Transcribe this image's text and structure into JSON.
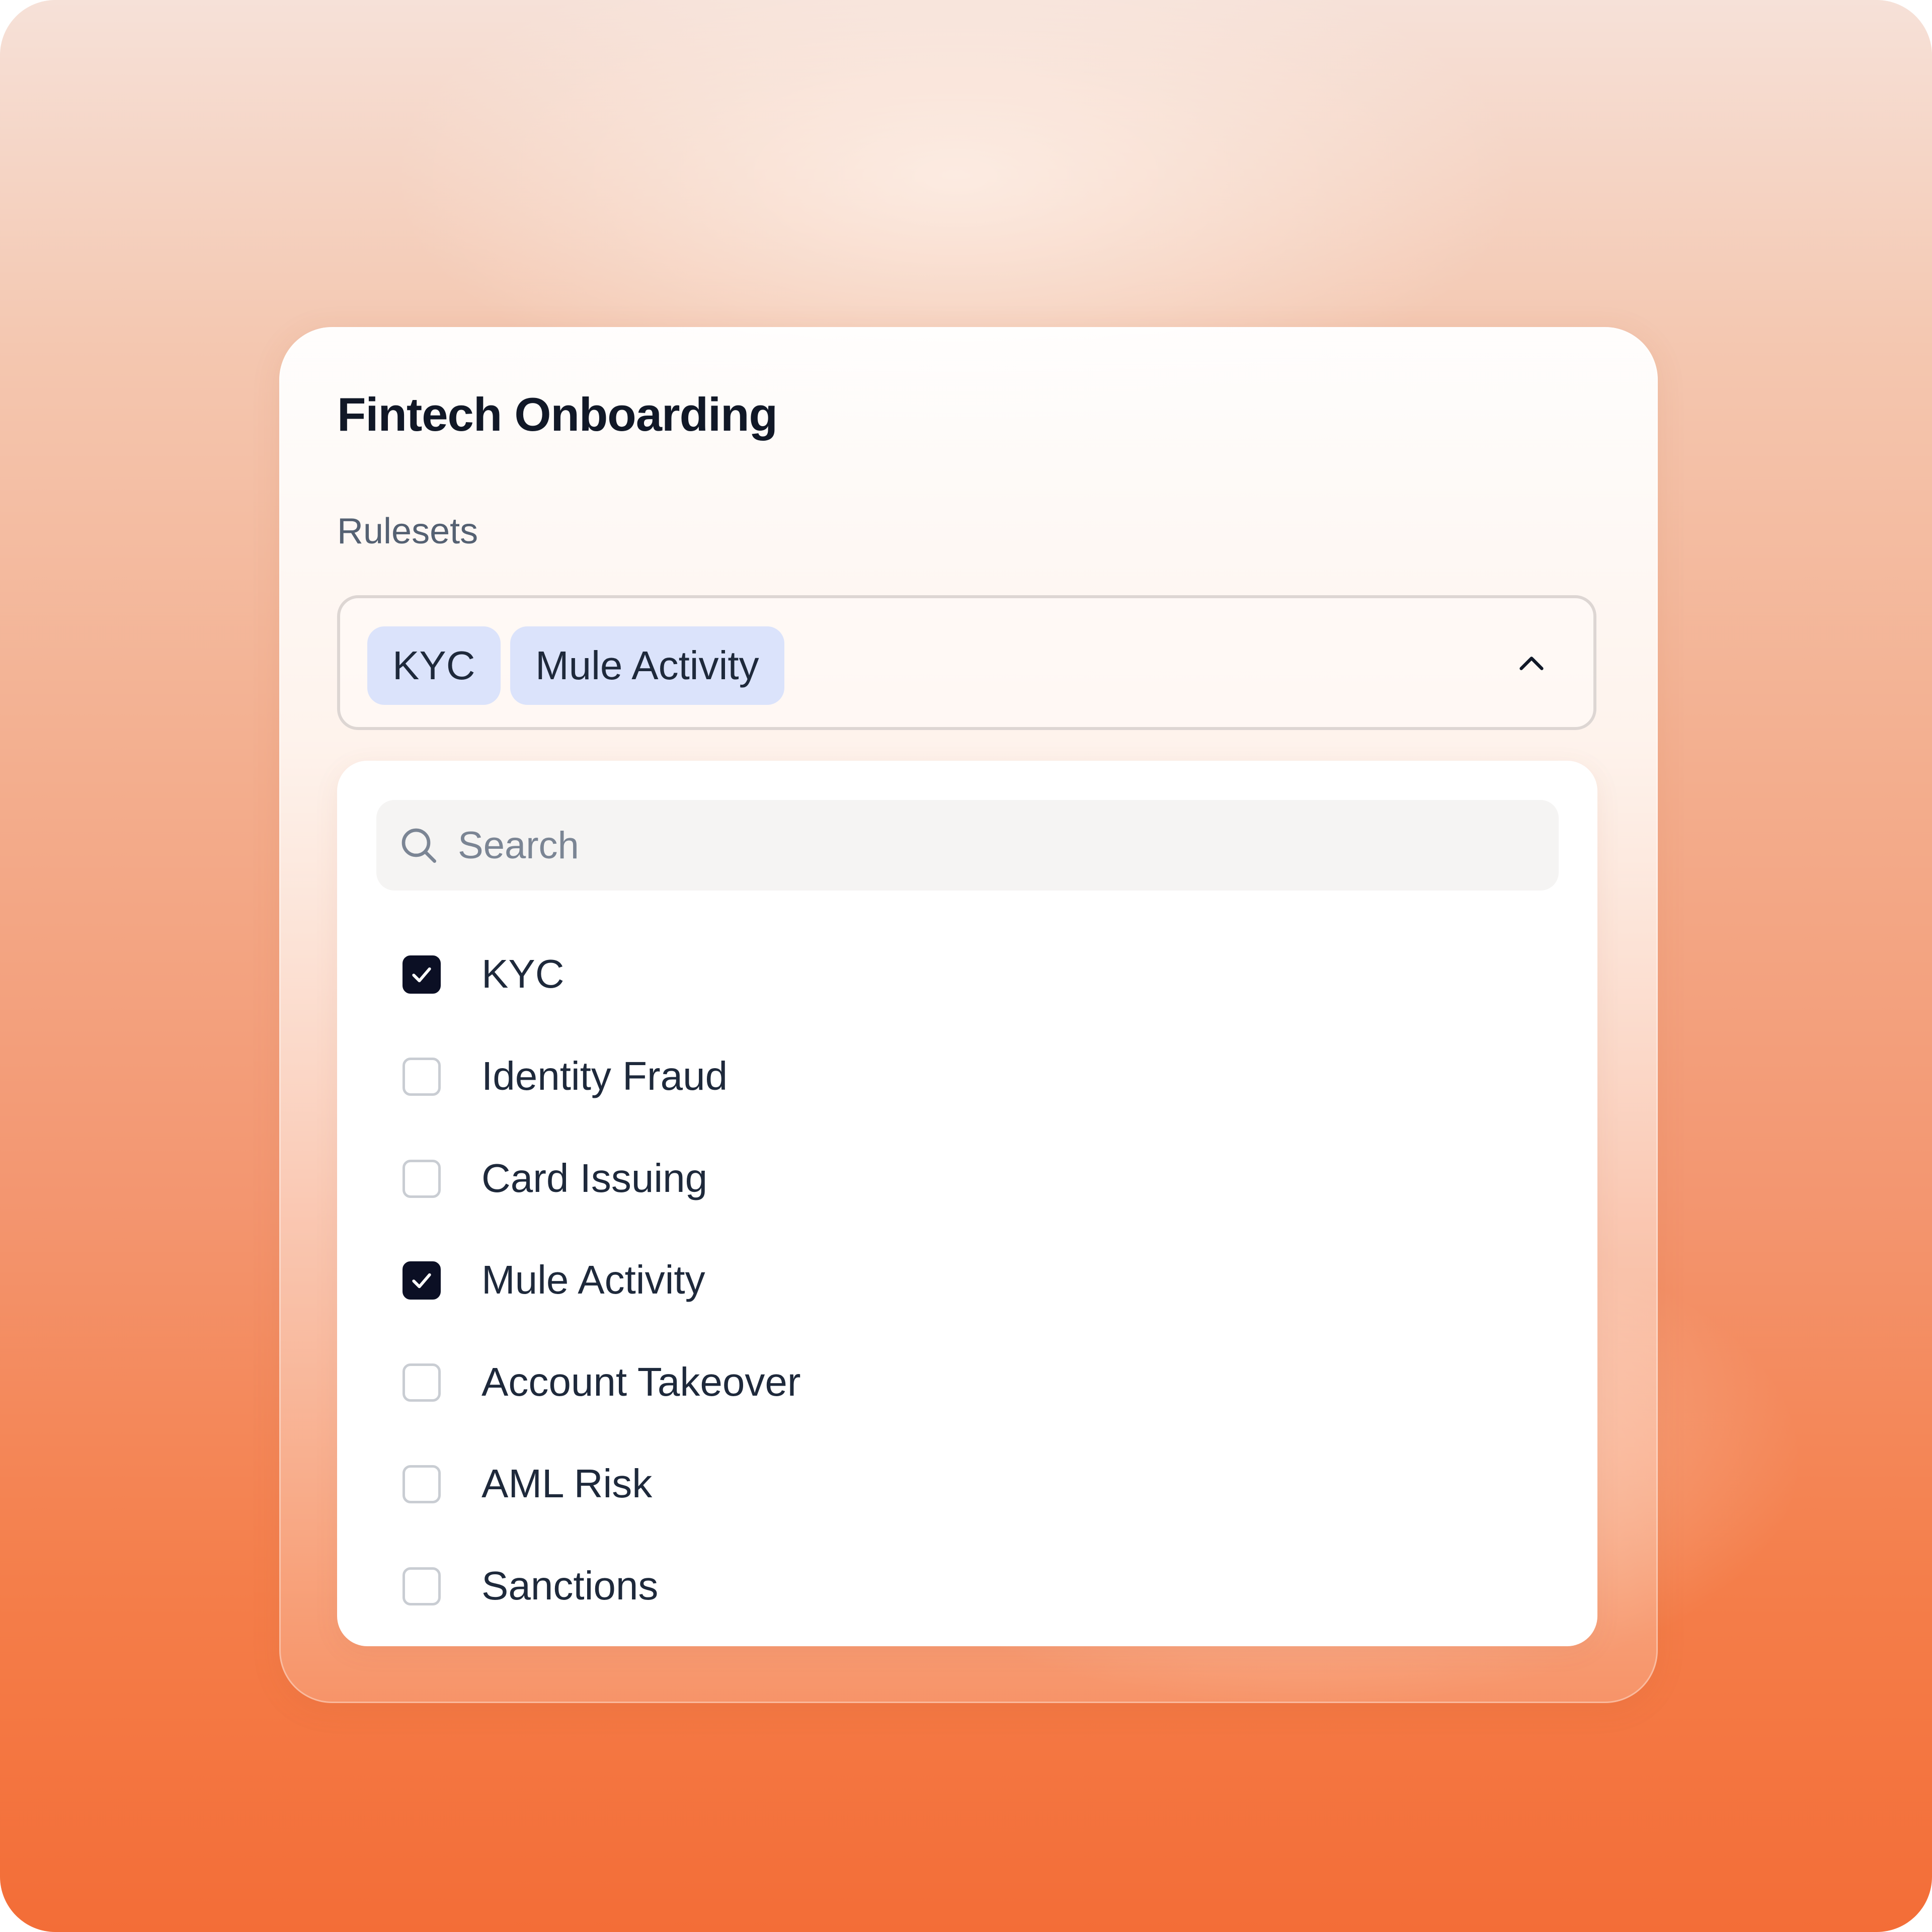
{
  "card": {
    "title": "Fintech Onboarding"
  },
  "rulesets": {
    "label": "Rulesets",
    "selected_chips": [
      "KYC",
      "Mule Activity"
    ],
    "expanded": true
  },
  "dropdown": {
    "search": {
      "placeholder": "Search",
      "value": ""
    },
    "options": [
      {
        "label": "KYC",
        "checked": true
      },
      {
        "label": "Identity Fraud",
        "checked": false
      },
      {
        "label": "Card Issuing",
        "checked": false
      },
      {
        "label": "Mule Activity",
        "checked": true
      },
      {
        "label": "Account Takeover",
        "checked": false
      },
      {
        "label": "AML Risk",
        "checked": false
      },
      {
        "label": "Sanctions",
        "checked": false
      }
    ]
  },
  "icons": {
    "toggle": "chevron-up-icon",
    "search": "search-icon",
    "check": "checkmark-icon"
  },
  "colors": {
    "chip_background": "#dbe3fb",
    "checkbox_checked": "#0b0f24",
    "text_primary": "#1e293b",
    "background_accent": "#f36d37"
  }
}
